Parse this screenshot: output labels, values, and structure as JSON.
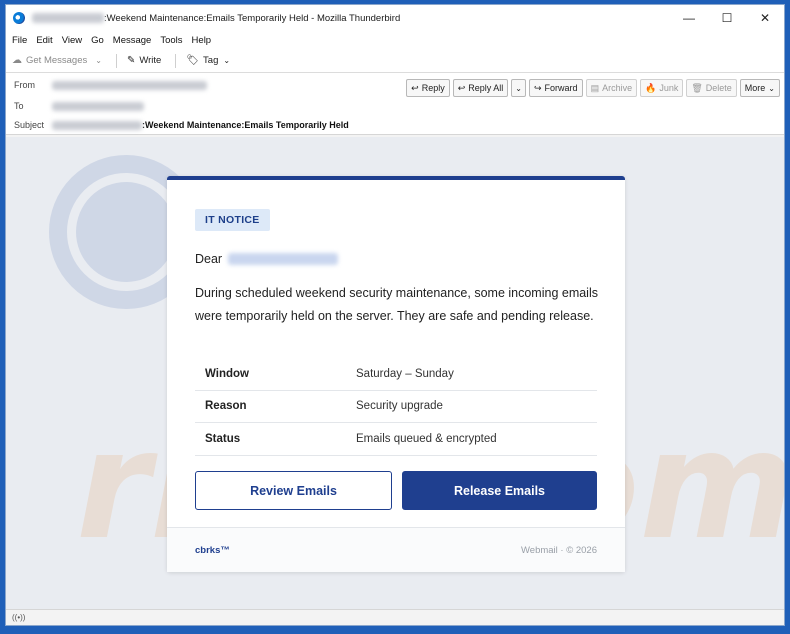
{
  "window": {
    "title_suffix": ":Weekend Maintenance:Emails Temporarily Held - Mozilla Thunderbird",
    "controls": {
      "minimize": "—",
      "maximize": "☐",
      "close": "✕"
    }
  },
  "menu": [
    "File",
    "Edit",
    "View",
    "Go",
    "Message",
    "Tools",
    "Help"
  ],
  "toolbar": {
    "get_messages": "Get Messages",
    "write": "Write",
    "tag": "Tag"
  },
  "header": {
    "from_label": "From",
    "to_label": "To",
    "subject_label": "Subject",
    "subject_suffix": ":Weekend Maintenance:Emails Temporarily Held",
    "actions": {
      "reply": "Reply",
      "reply_all": "Reply All",
      "forward": "Forward",
      "archive": "Archive",
      "junk": "Junk",
      "delete": "Delete",
      "more": "More"
    }
  },
  "email": {
    "badge": "IT NOTICE",
    "greeting": "Dear",
    "body": "During scheduled weekend security maintenance, some incoming emails were temporarily held on the server. They are safe and pending release.",
    "rows": [
      {
        "key": "Window",
        "value": "Saturday – Sunday"
      },
      {
        "key": "Reason",
        "value": "Security upgrade"
      },
      {
        "key": "Status",
        "value": "Emails queued & encrypted"
      }
    ],
    "review_button": "Review Emails",
    "release_button": "Release Emails",
    "footer_brand": "cbrks™",
    "footer_right": "Webmail · © 2026"
  },
  "colors": {
    "accent": "#1f3f8f",
    "badge_bg": "#dde9f8",
    "window_frame": "#1f5fb8"
  }
}
